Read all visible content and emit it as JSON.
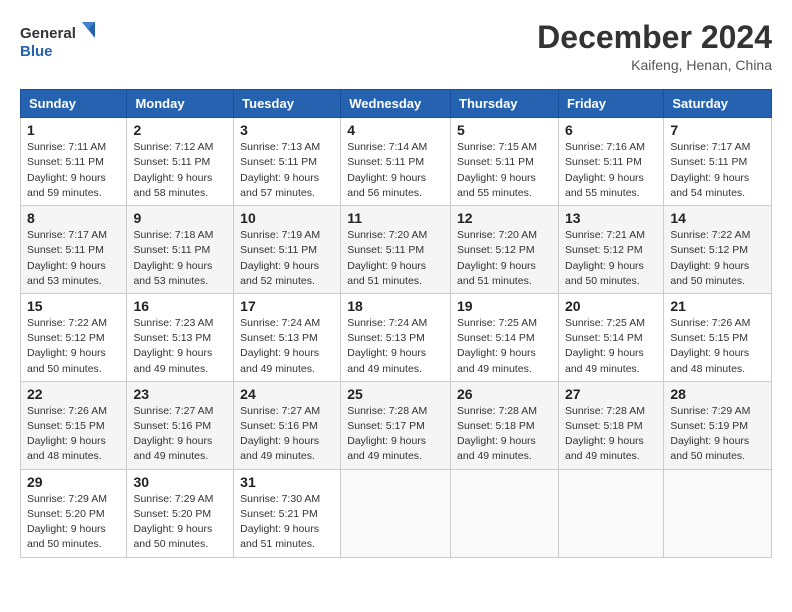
{
  "logo": {
    "line1": "General",
    "line2": "Blue"
  },
  "title": "December 2024",
  "location": "Kaifeng, Henan, China",
  "weekdays": [
    "Sunday",
    "Monday",
    "Tuesday",
    "Wednesday",
    "Thursday",
    "Friday",
    "Saturday"
  ],
  "weeks": [
    [
      {
        "day": "1",
        "info": "Sunrise: 7:11 AM\nSunset: 5:11 PM\nDaylight: 9 hours\nand 59 minutes."
      },
      {
        "day": "2",
        "info": "Sunrise: 7:12 AM\nSunset: 5:11 PM\nDaylight: 9 hours\nand 58 minutes."
      },
      {
        "day": "3",
        "info": "Sunrise: 7:13 AM\nSunset: 5:11 PM\nDaylight: 9 hours\nand 57 minutes."
      },
      {
        "day": "4",
        "info": "Sunrise: 7:14 AM\nSunset: 5:11 PM\nDaylight: 9 hours\nand 56 minutes."
      },
      {
        "day": "5",
        "info": "Sunrise: 7:15 AM\nSunset: 5:11 PM\nDaylight: 9 hours\nand 55 minutes."
      },
      {
        "day": "6",
        "info": "Sunrise: 7:16 AM\nSunset: 5:11 PM\nDaylight: 9 hours\nand 55 minutes."
      },
      {
        "day": "7",
        "info": "Sunrise: 7:17 AM\nSunset: 5:11 PM\nDaylight: 9 hours\nand 54 minutes."
      }
    ],
    [
      {
        "day": "8",
        "info": "Sunrise: 7:17 AM\nSunset: 5:11 PM\nDaylight: 9 hours\nand 53 minutes."
      },
      {
        "day": "9",
        "info": "Sunrise: 7:18 AM\nSunset: 5:11 PM\nDaylight: 9 hours\nand 53 minutes."
      },
      {
        "day": "10",
        "info": "Sunrise: 7:19 AM\nSunset: 5:11 PM\nDaylight: 9 hours\nand 52 minutes."
      },
      {
        "day": "11",
        "info": "Sunrise: 7:20 AM\nSunset: 5:11 PM\nDaylight: 9 hours\nand 51 minutes."
      },
      {
        "day": "12",
        "info": "Sunrise: 7:20 AM\nSunset: 5:12 PM\nDaylight: 9 hours\nand 51 minutes."
      },
      {
        "day": "13",
        "info": "Sunrise: 7:21 AM\nSunset: 5:12 PM\nDaylight: 9 hours\nand 50 minutes."
      },
      {
        "day": "14",
        "info": "Sunrise: 7:22 AM\nSunset: 5:12 PM\nDaylight: 9 hours\nand 50 minutes."
      }
    ],
    [
      {
        "day": "15",
        "info": "Sunrise: 7:22 AM\nSunset: 5:12 PM\nDaylight: 9 hours\nand 50 minutes."
      },
      {
        "day": "16",
        "info": "Sunrise: 7:23 AM\nSunset: 5:13 PM\nDaylight: 9 hours\nand 49 minutes."
      },
      {
        "day": "17",
        "info": "Sunrise: 7:24 AM\nSunset: 5:13 PM\nDaylight: 9 hours\nand 49 minutes."
      },
      {
        "day": "18",
        "info": "Sunrise: 7:24 AM\nSunset: 5:13 PM\nDaylight: 9 hours\nand 49 minutes."
      },
      {
        "day": "19",
        "info": "Sunrise: 7:25 AM\nSunset: 5:14 PM\nDaylight: 9 hours\nand 49 minutes."
      },
      {
        "day": "20",
        "info": "Sunrise: 7:25 AM\nSunset: 5:14 PM\nDaylight: 9 hours\nand 49 minutes."
      },
      {
        "day": "21",
        "info": "Sunrise: 7:26 AM\nSunset: 5:15 PM\nDaylight: 9 hours\nand 48 minutes."
      }
    ],
    [
      {
        "day": "22",
        "info": "Sunrise: 7:26 AM\nSunset: 5:15 PM\nDaylight: 9 hours\nand 48 minutes."
      },
      {
        "day": "23",
        "info": "Sunrise: 7:27 AM\nSunset: 5:16 PM\nDaylight: 9 hours\nand 49 minutes."
      },
      {
        "day": "24",
        "info": "Sunrise: 7:27 AM\nSunset: 5:16 PM\nDaylight: 9 hours\nand 49 minutes."
      },
      {
        "day": "25",
        "info": "Sunrise: 7:28 AM\nSunset: 5:17 PM\nDaylight: 9 hours\nand 49 minutes."
      },
      {
        "day": "26",
        "info": "Sunrise: 7:28 AM\nSunset: 5:18 PM\nDaylight: 9 hours\nand 49 minutes."
      },
      {
        "day": "27",
        "info": "Sunrise: 7:28 AM\nSunset: 5:18 PM\nDaylight: 9 hours\nand 49 minutes."
      },
      {
        "day": "28",
        "info": "Sunrise: 7:29 AM\nSunset: 5:19 PM\nDaylight: 9 hours\nand 50 minutes."
      }
    ],
    [
      {
        "day": "29",
        "info": "Sunrise: 7:29 AM\nSunset: 5:20 PM\nDaylight: 9 hours\nand 50 minutes."
      },
      {
        "day": "30",
        "info": "Sunrise: 7:29 AM\nSunset: 5:20 PM\nDaylight: 9 hours\nand 50 minutes."
      },
      {
        "day": "31",
        "info": "Sunrise: 7:30 AM\nSunset: 5:21 PM\nDaylight: 9 hours\nand 51 minutes."
      },
      null,
      null,
      null,
      null
    ]
  ]
}
